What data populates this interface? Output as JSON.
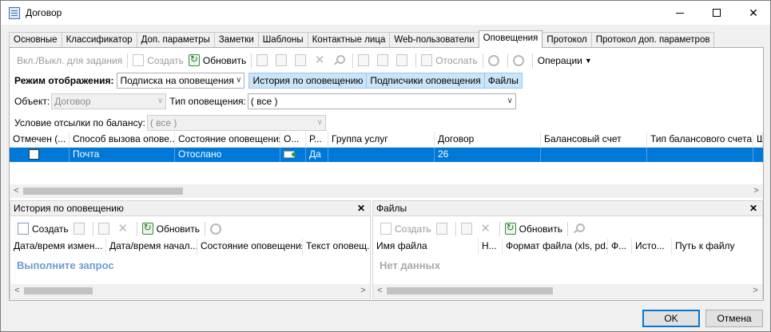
{
  "window": {
    "title": "Договор",
    "close_glyph": "✕"
  },
  "tabs": [
    "Основные",
    "Классификатор",
    "Доп. параметры",
    "Заметки",
    "Шаблоны",
    "Контактные лица",
    "Web-пользователи",
    "Оповещения",
    "Протокол",
    "Протокол доп. параметров"
  ],
  "toolbar": {
    "toggle_label": "Вкл./Выкл. для задания",
    "create_label": "Создать",
    "refresh_label": "Обновить",
    "send_label": "Отослать",
    "operations_label": "Операции"
  },
  "display_mode": {
    "label": "Режим отображения:",
    "value": "Подписка на оповещения",
    "subtabs": [
      "История по оповещению",
      "Подписчики оповещения",
      "Файлы"
    ]
  },
  "filters": {
    "object_label": "Объект:",
    "object_value": "Договор",
    "type_label": "Тип оповещения:",
    "type_value": "( все )",
    "balance_label": "Условие отсылки по балансу:",
    "balance_value": "( все )"
  },
  "grid": {
    "columns": [
      "Отмечен (...",
      "Способ вызова опове...",
      "Состояние оповещения",
      "О...",
      "Р...",
      "Группа услуг",
      "Договор",
      "Балансовый счет",
      "Тип балансового счета",
      "Ш"
    ],
    "rows": [
      {
        "marked": false,
        "method": "Почта",
        "state": "Отослано",
        "r": "Да",
        "group": "",
        "contract": "26",
        "account": "",
        "account_type": ""
      }
    ]
  },
  "history_panel": {
    "title": "История по оповещению",
    "create_label": "Создать",
    "refresh_label": "Обновить",
    "columns": [
      "Дата/время измен...",
      "Дата/время начал...",
      "Состояние оповещения",
      "Текст оповещ..."
    ],
    "empty_text": "Выполните запрос"
  },
  "files_panel": {
    "title": "Файлы",
    "create_label": "Создать",
    "refresh_label": "Обновить",
    "columns": [
      "Имя файла",
      "Н...",
      "Формат файла (xls, pd...",
      "Ф...",
      "Исто...",
      "Путь к файлу"
    ],
    "empty_text": "Нет данных"
  },
  "buttons": {
    "ok": "OK",
    "cancel": "Отмена"
  },
  "colors": {
    "selection": "#0078d7",
    "subtab_bg": "#cce4f7",
    "empty_blue": "#6b9bd1"
  }
}
